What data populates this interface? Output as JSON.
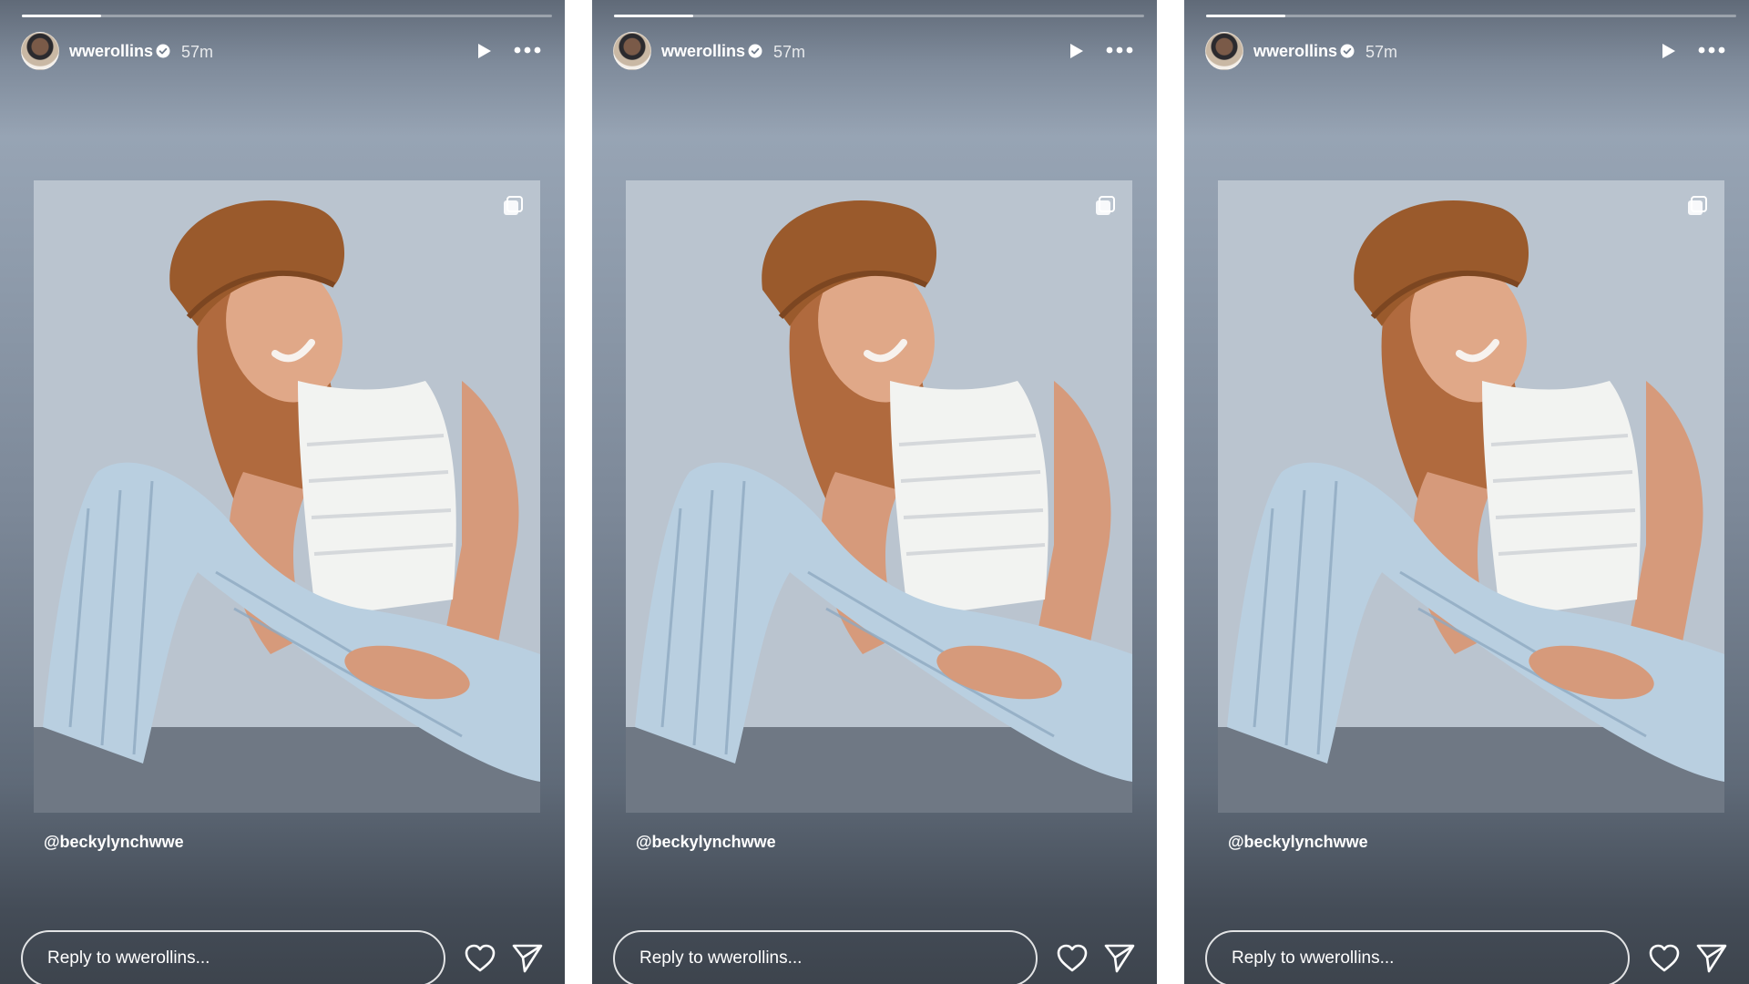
{
  "stories": [
    {
      "username": "wwerollins",
      "time_ago": "57m",
      "mention": "@beckylynchwwe",
      "reply_placeholder": "Reply to wwerollins...",
      "progress_fraction": 0.15
    },
    {
      "username": "wwerollins",
      "time_ago": "57m",
      "mention": "@beckylynchwwe",
      "reply_placeholder": "Reply to wwerollins...",
      "progress_fraction": 0.15
    },
    {
      "username": "wwerollins",
      "time_ago": "57m",
      "mention": "@beckylynchwwe",
      "reply_placeholder": "Reply to wwerollins...",
      "progress_fraction": 0.15
    }
  ],
  "icons": {
    "header": [
      "verified-badge-icon",
      "play-icon",
      "more-options-icon"
    ],
    "photo": [
      "multiple-photos-icon"
    ],
    "footer": [
      "heart-icon",
      "send-icon"
    ]
  },
  "colors": {
    "text": "#ffffff",
    "photo_background": "#a9b5c2",
    "hat": "#9a5a2c",
    "hair": "#b06a3e",
    "jeans": "#b9cfe0",
    "top": "#f2f3f1"
  }
}
